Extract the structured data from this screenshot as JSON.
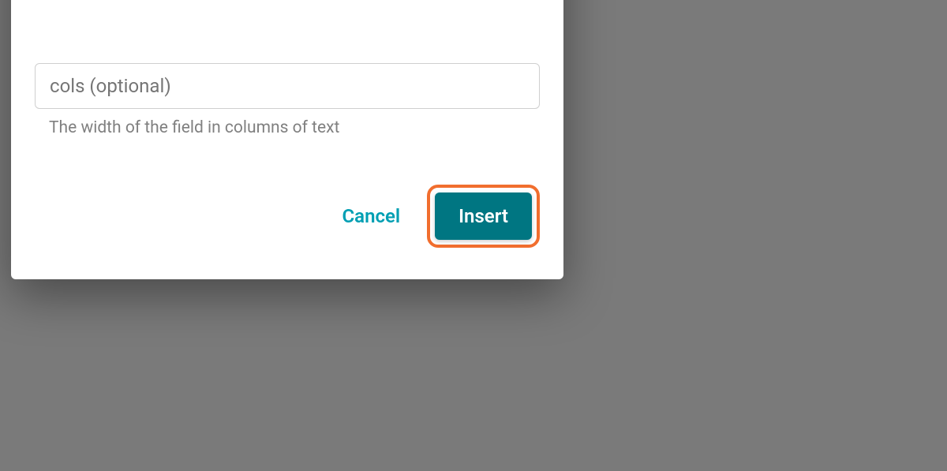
{
  "dialog": {
    "input": {
      "placeholder": "cols (optional)",
      "value": ""
    },
    "help_text": "The width of the field in columns of text",
    "actions": {
      "cancel_label": "Cancel",
      "insert_label": "Insert"
    }
  }
}
